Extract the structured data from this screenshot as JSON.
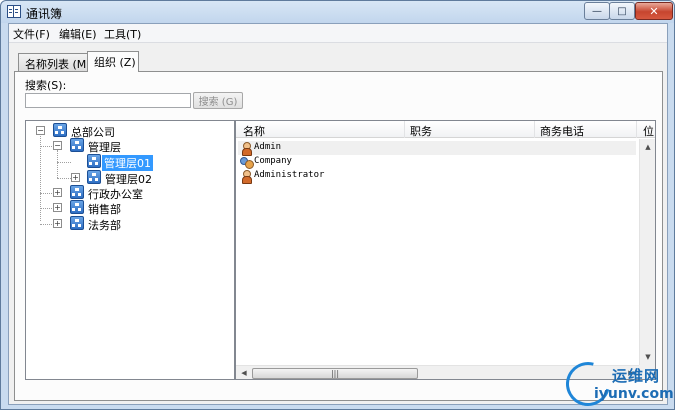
{
  "window": {
    "title": "通讯簿",
    "controls": {
      "minimize": "—",
      "maximize": "□",
      "close": "✕"
    }
  },
  "menu": {
    "items": [
      "文件(F)",
      "编辑(E)",
      "工具(T)"
    ]
  },
  "tabs": [
    {
      "label": "名称列表 (M)",
      "active": false
    },
    {
      "label": "组织 (Z)",
      "active": true
    }
  ],
  "search": {
    "label": "搜索(S):",
    "value": "",
    "button": "搜索 (G)"
  },
  "tree": {
    "root": "总部公司",
    "children": [
      "管理层",
      "行政办公室",
      "销售部",
      "法务部"
    ],
    "management_children": [
      "管理层01",
      "管理层02"
    ],
    "selected": "管理层01",
    "expander_open": "−",
    "expander_closed": "+"
  },
  "list": {
    "columns": [
      "名称",
      "职务",
      "商务电话",
      "位"
    ],
    "rows": [
      {
        "name": "Admin",
        "icon": "user-icon"
      },
      {
        "name": "Company",
        "icon": "company-icon"
      },
      {
        "name": "Administrator",
        "icon": "user-icon"
      }
    ]
  },
  "scroll": {
    "up": "▲",
    "down": "▼",
    "left": "◀",
    "right": "▶",
    "grip": "|||"
  },
  "watermark": {
    "title": "运维网",
    "url": "iyunv.com"
  }
}
